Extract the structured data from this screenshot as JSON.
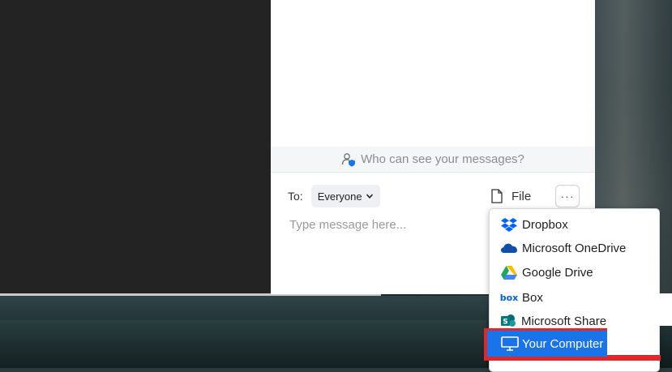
{
  "chat": {
    "privacy_text": "Who can see your messages?",
    "to_label": "To:",
    "recipient": "Everyone",
    "file_label": "File",
    "more_label": "···",
    "message_placeholder": "Type message here..."
  },
  "share_menu": {
    "items": [
      {
        "label": "Dropbox",
        "icon": "dropbox-icon"
      },
      {
        "label": "Microsoft OneDrive",
        "icon": "onedrive-icon"
      },
      {
        "label": "Google Drive",
        "icon": "google-drive-icon"
      },
      {
        "label": "Box",
        "icon": "box-icon"
      },
      {
        "label": "Microsoft Share",
        "icon": "sharepoint-icon"
      }
    ],
    "selected": {
      "label": "Your Computer",
      "icon": "computer-icon"
    }
  },
  "colors": {
    "accent": "#1a73e8",
    "highlight_border": "#e3262b",
    "dark_panel": "#232323"
  }
}
